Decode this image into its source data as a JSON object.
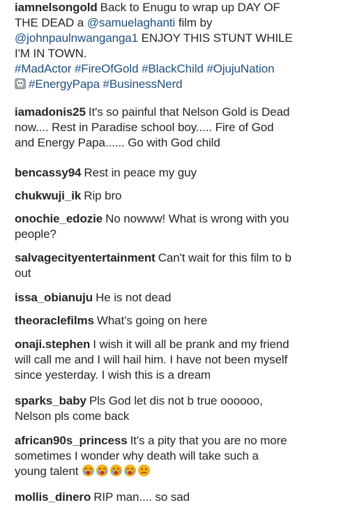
{
  "caption": {
    "username": "iamnelsongold",
    "text_1": "Back to Enugu to wrap up DAY OF",
    "text_2": "THE DEAD a",
    "mention_1": "@samuelaghanti",
    "text_3": "film by",
    "mention_2": "@johnpaulnwanganga1",
    "text_4": "ENJOY THIS STUNT WHILE",
    "text_5": "I'M IN TOWN.",
    "hashtags_line_1": [
      "#MadActor",
      "#FireOfGold",
      "#BlackChild",
      "#OjujuNation"
    ],
    "skull_icon": "skull-icon",
    "hashtags_line_2": [
      "#EnergyPapa",
      "#BusinessNerd"
    ]
  },
  "comments": [
    {
      "username": "iamadonis25",
      "lines": [
        "It's so painful that Nelson Gold is Dead",
        "now.... Rest in Paradise school boy..... Fire of God",
        "and Energy Papa...... Go with God child"
      ]
    },
    {
      "username": "bencassy94",
      "lines": [
        "Rest in peace my guy"
      ]
    },
    {
      "username": "chukwuji_ik",
      "lines": [
        "Rip bro"
      ]
    },
    {
      "username": "onochie_edozie",
      "lines": [
        "No nowww! What is wrong with you",
        "people?"
      ]
    },
    {
      "username": "salvagecityentertainment",
      "lines": [
        "Can't wait for this film to b",
        "out"
      ]
    },
    {
      "username": "issa_obianuju",
      "lines": [
        "He is not dead"
      ]
    },
    {
      "username": "theoraclefilms",
      "lines": [
        "What’s going on here"
      ]
    },
    {
      "username": "onaji.stephen",
      "lines": [
        "I wish it will all be prank and my friend",
        "will call me and I will hail him. I have not been myself",
        "since yesterday. I wish this is a dream"
      ]
    },
    {
      "username": "sparks_baby",
      "lines": [
        "Pls God let dis not b true oooooo,",
        "Nelson pls come back"
      ]
    },
    {
      "username": "african90s_princess",
      "lines": [
        "It's a pity that you are no more",
        "sometimes I wonder why death will take such a",
        "young talent"
      ],
      "emojis": [
        "crying-face-icon",
        "crying-face-icon",
        "crying-face-icon",
        "crying-face-icon",
        "frowning-face-icon"
      ]
    },
    {
      "username": "mollis_dinero",
      "lines": [
        "RIP man.... so sad"
      ]
    }
  ],
  "colors": {
    "text": "#262626",
    "link": "#1f4f7d",
    "emoji_face": "#f7b21b",
    "emoji_tear": "#5aa6e6",
    "emoji_mouth": "#c0392b"
  }
}
